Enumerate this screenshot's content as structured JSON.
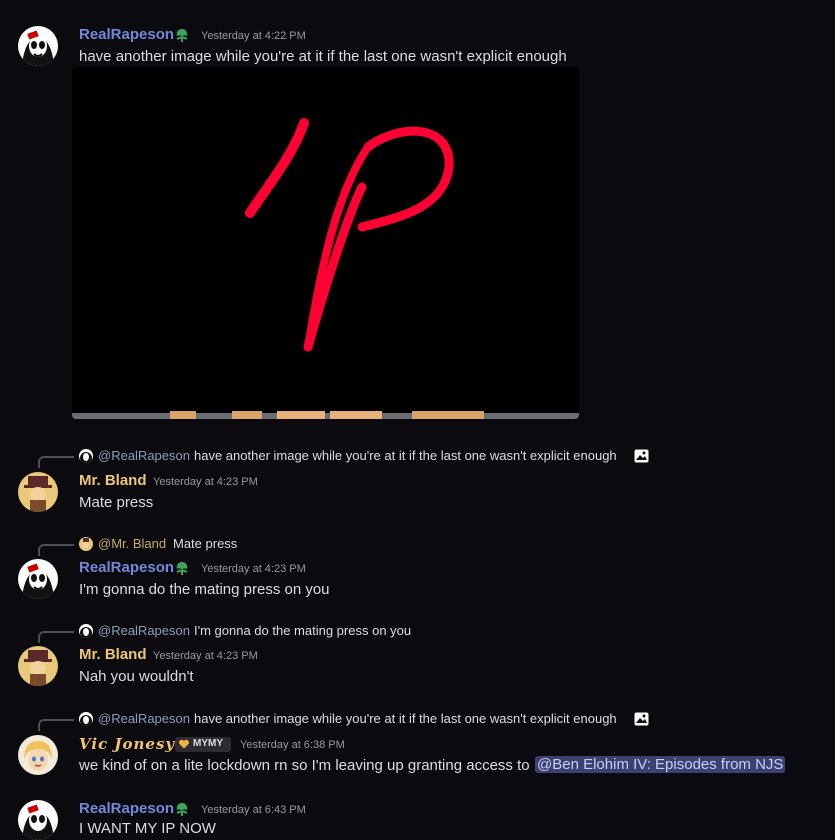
{
  "messages": [
    {
      "username": "RealRapeson",
      "timestamp": "Yesterday at 4:22 PM",
      "text": "have another image while you're at it if the last one wasn't explicit enough"
    },
    {
      "reply": {
        "name": "@RealRapeson",
        "text": "have another image while you're at it if the last one wasn't explicit enough"
      },
      "username": "Mr. Bland",
      "timestamp": "Yesterday at 4:23 PM",
      "text": "Mate press"
    },
    {
      "reply": {
        "name": "@Mr. Bland",
        "text": "Mate press"
      },
      "username": "RealRapeson",
      "timestamp": "Yesterday at 4:23 PM",
      "text": "I'm gonna do the mating press on you"
    },
    {
      "reply": {
        "name": "@RealRapeson",
        "text": "I'm gonna do the mating press on you"
      },
      "username": "Mr. Bland",
      "timestamp": "Yesterday at 4:23 PM",
      "text": "Nah you wouldn't"
    },
    {
      "reply": {
        "name": "@RealRapeson",
        "text": "have another image while you're at it if the last one wasn't explicit enough"
      },
      "username": "Vic Jonesy",
      "tag": "MYMY",
      "timestamp": "Yesterday at 6:38 PM",
      "text": "we kind of on a lite lockdown rn so I'm leaving up granting access to",
      "mention": "@Ben Elohim IV: Episodes from NJS"
    },
    {
      "username": "RealRapeson",
      "timestamp": "Yesterday at 6:43 PM",
      "text": "I WANT MY IP NOW"
    }
  ],
  "colors": {
    "background": "#0b0b0f",
    "rapeson_name": "#7289da",
    "bland_name": "#f0c674",
    "vic_name": "#f5c46b",
    "mention_bg": "#3c4270",
    "drawing_stroke": "#ff0033"
  },
  "icons": [
    "green-leaf-badge-icon",
    "image-attachment-icon",
    "heart-tag-icon"
  ]
}
